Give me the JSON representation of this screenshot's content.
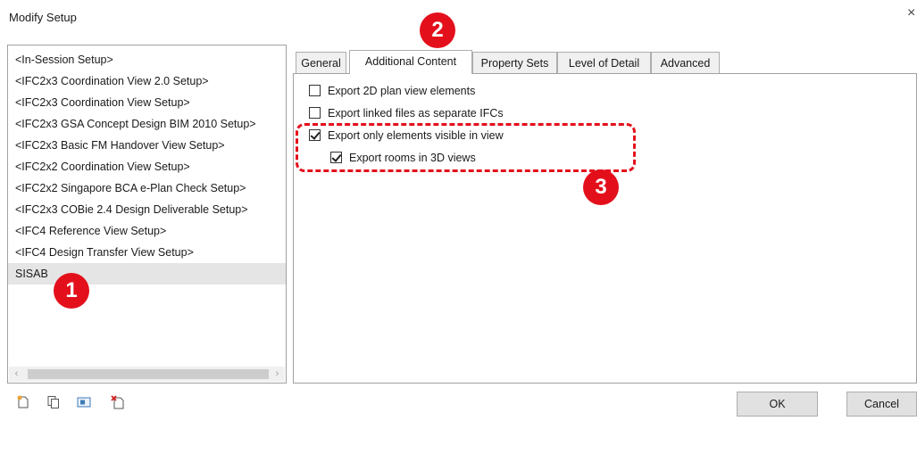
{
  "window": {
    "title": "Modify Setup",
    "close": "×"
  },
  "setups": [
    {
      "label": "<In-Session Setup>"
    },
    {
      "label": "<IFC2x3 Coordination View 2.0 Setup>"
    },
    {
      "label": "<IFC2x3 Coordination View Setup>"
    },
    {
      "label": "<IFC2x3 GSA Concept Design BIM 2010 Setup>"
    },
    {
      "label": "<IFC2x3 Basic FM Handover View Setup>"
    },
    {
      "label": "<IFC2x2 Coordination View Setup>"
    },
    {
      "label": "<IFC2x2 Singapore BCA e-Plan Check Setup>"
    },
    {
      "label": "<IFC2x3 COBie 2.4 Design Deliverable Setup>"
    },
    {
      "label": "<IFC4 Reference View Setup>"
    },
    {
      "label": "<IFC4 Design Transfer View Setup>"
    },
    {
      "label": "SISAB",
      "selected": true
    }
  ],
  "scrollbar": {
    "left": "‹",
    "right": "›"
  },
  "tabs": [
    {
      "label": "General"
    },
    {
      "label": "Additional Content",
      "active": true
    },
    {
      "label": "Property Sets"
    },
    {
      "label": "Level of Detail"
    },
    {
      "label": "Advanced"
    }
  ],
  "options": [
    {
      "label": "Export 2D plan view elements",
      "checked": false
    },
    {
      "label": "Export linked files as separate IFCs",
      "checked": false
    },
    {
      "label": "Export only elements visible in view",
      "checked": true
    },
    {
      "label": "Export rooms in 3D views",
      "checked": true
    }
  ],
  "toolbar_icons": [
    "new-setup-icon",
    "duplicate-setup-icon",
    "rename-setup-icon",
    "delete-setup-icon"
  ],
  "buttons": {
    "ok": "OK",
    "cancel": "Cancel"
  },
  "annotations": {
    "badge_1": "1",
    "badge_2": "2",
    "badge_3": "3",
    "color": "#e3101b"
  }
}
